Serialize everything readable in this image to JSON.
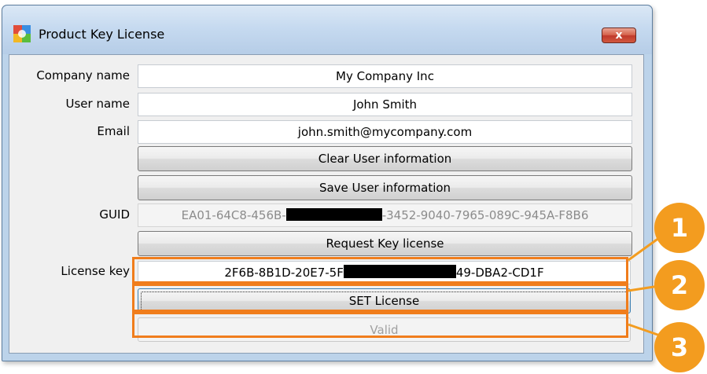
{
  "window": {
    "title": "Product Key License",
    "close_label": "x"
  },
  "form": {
    "company_label": "Company name",
    "company_value": "My Company Inc",
    "user_label": "User name",
    "user_value": "John Smith",
    "email_label": "Email",
    "email_value": "john.smith@mycompany.com",
    "clear_button": "Clear User information",
    "save_button": "Save User information",
    "guid_label": "GUID",
    "guid_prefix": "EA01-64C8-456B-",
    "guid_suffix": "-3452-9040-7965-089C-945A-F8B6",
    "request_button": "Request Key license",
    "license_label": "License key",
    "license_prefix": "2F6B-8B1D-20E7-5F",
    "license_suffix": "49-DBA2-CD1F",
    "set_button": "SET License",
    "status_value": "Valid"
  },
  "callouts": [
    "1",
    "2",
    "3"
  ],
  "colors": {
    "callout": "#f39c1f",
    "highlight": "#f07d1c",
    "close_button": "#c0392b"
  }
}
